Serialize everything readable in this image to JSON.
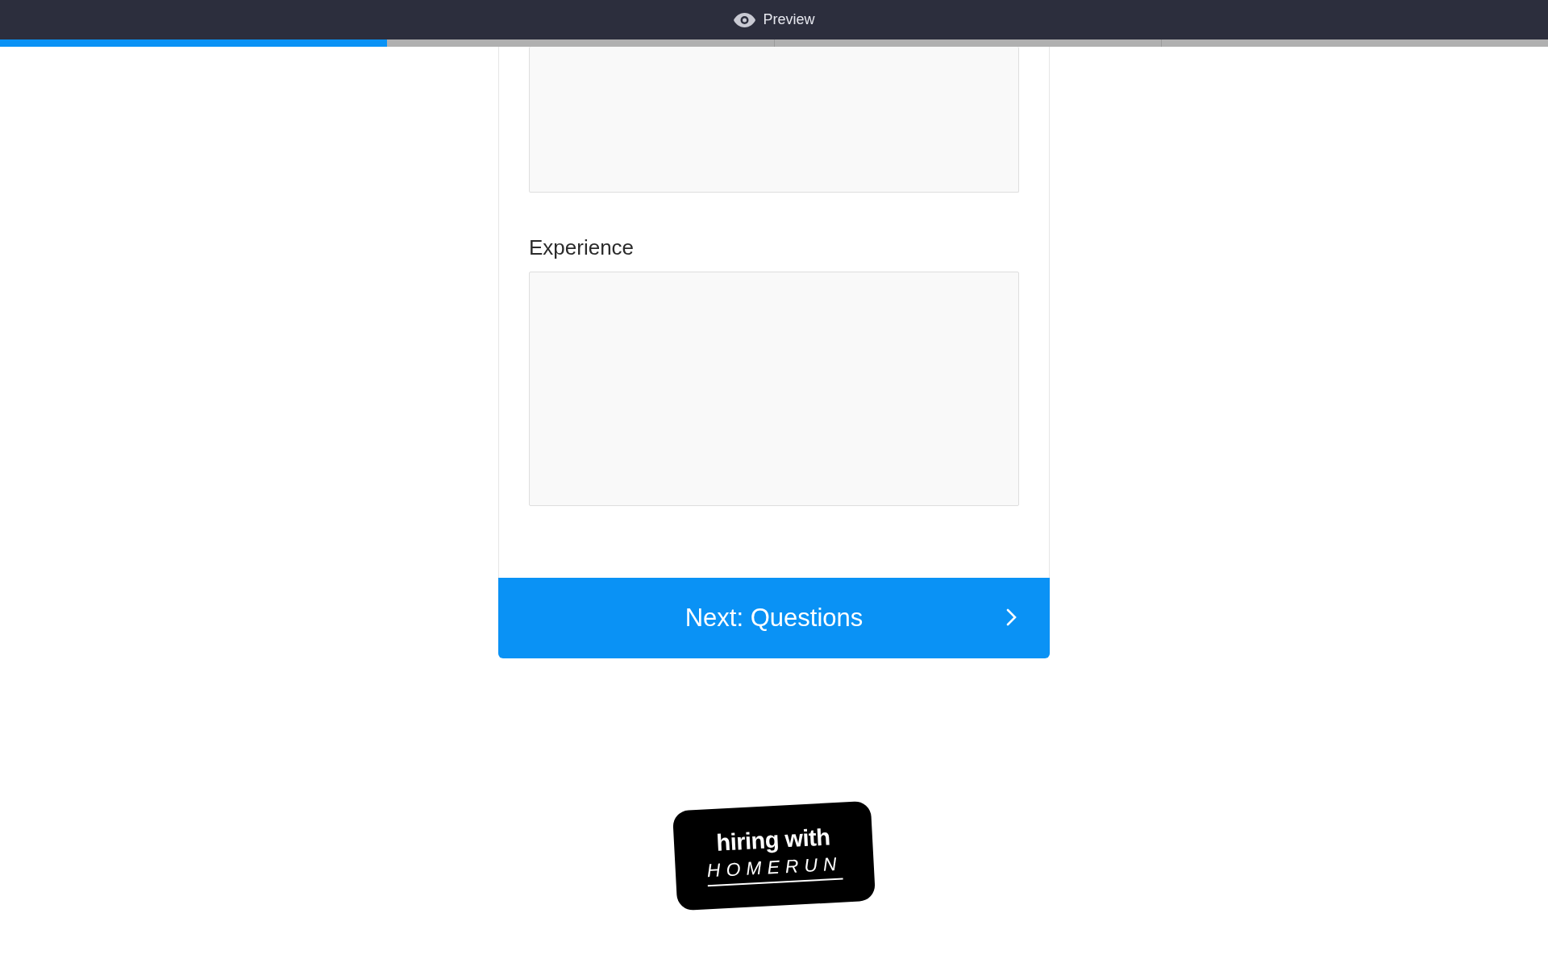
{
  "top_bar": {
    "title": "Preview"
  },
  "progress": {
    "level": 0.25
  },
  "form": {
    "fields": [
      {
        "kind": "textarea"
      },
      {
        "label": "Experience",
        "kind": "textarea"
      }
    ]
  },
  "next_button": {
    "label": "Next: Questions"
  },
  "badge": {
    "line_1": "hiring with",
    "line_2": "HOMERUN"
  }
}
